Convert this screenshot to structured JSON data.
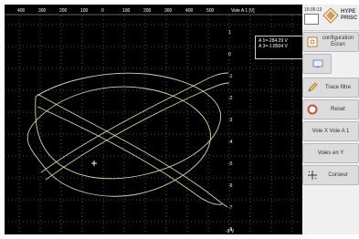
{
  "window": {
    "title": "",
    "top_scale_labels": [
      "400",
      "300",
      "200",
      "100",
      "0",
      "100",
      "200",
      "300",
      "400",
      "500"
    ],
    "top_scale_right_label": "Voie A 1 [V]",
    "right_axis_labels": [
      "1",
      "0",
      "-1",
      "-2",
      "-3",
      "-4",
      "-5",
      "-6",
      "-7",
      "-8",
      "-9"
    ],
    "right_axis_bottom_label": "-9 V"
  },
  "status": {
    "date_text": "16:06:13",
    "logo_text_line1": "HYPE",
    "logo_text_line2": "PRISC"
  },
  "readout": {
    "line1": "A 1=-284.29 V",
    "line2": "A 3=-1.8504 V"
  },
  "panel": {
    "configuration_label": "configuration Ecran",
    "trace_label": "Trace filtre",
    "reset_label": "Reset",
    "voie_x_label": "Voie X Voie A 1",
    "voies_y_label": "Voies en Y",
    "cursor_label": "Curseur"
  },
  "icons": {
    "configuration": "screen-settings-icon",
    "blank": "monitor-icon",
    "trace": "pencil-icon",
    "reset": "reset-icon",
    "cursor": "cursor-icon",
    "logo": "brand-logo-icon",
    "status": "small-screen-icon"
  },
  "colors": {
    "trace": "#e2e2a2",
    "grid": "#5a5a5a",
    "panel_bg": "#f0f0f0",
    "button_bg": "#dcdcdc"
  }
}
